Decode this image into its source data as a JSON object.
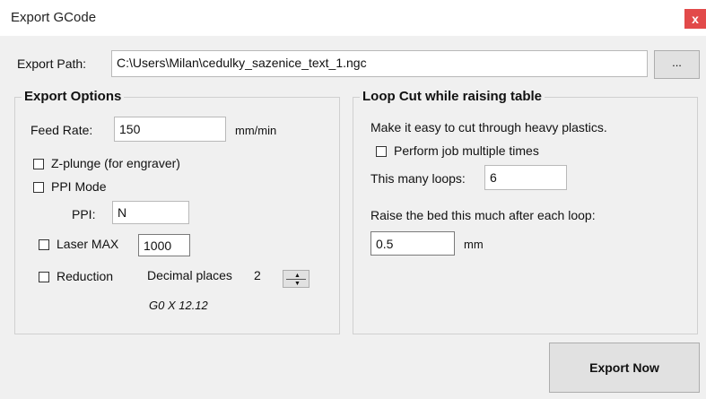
{
  "window": {
    "title": "Export GCode",
    "close_label": "x"
  },
  "export_path": {
    "label": "Export Path:",
    "value": "C:\\Users\\Milan\\cedulky_sazenice_text_1.ngc",
    "browse_label": "..."
  },
  "export_options": {
    "title": "Export Options",
    "feed_rate": {
      "label": "Feed Rate:",
      "value": "150",
      "unit": "mm/min"
    },
    "z_plunge": {
      "label": "Z-plunge (for engraver)",
      "checked": false
    },
    "ppi_mode": {
      "label": "PPI Mode",
      "checked": false
    },
    "ppi": {
      "label": "PPI:",
      "value": "N"
    },
    "laser_max": {
      "label": "Laser MAX",
      "checked": false,
      "value": "1000"
    },
    "reduction": {
      "label": "Reduction",
      "checked": false
    },
    "decimal_places": {
      "label": "Decimal places",
      "value": "2"
    },
    "preview": "G0 X 12.12"
  },
  "loop_cut": {
    "title": "Loop Cut while raising table",
    "description": "Make it easy to cut through heavy plastics.",
    "multiple": {
      "label": "Perform job multiple times",
      "checked": false
    },
    "loops": {
      "label": "This many loops:",
      "value": "6"
    },
    "raise_label": "Raise the bed this much after each loop:",
    "raise": {
      "value": "0.5",
      "unit": "mm"
    }
  },
  "actions": {
    "export_now": "Export Now"
  }
}
